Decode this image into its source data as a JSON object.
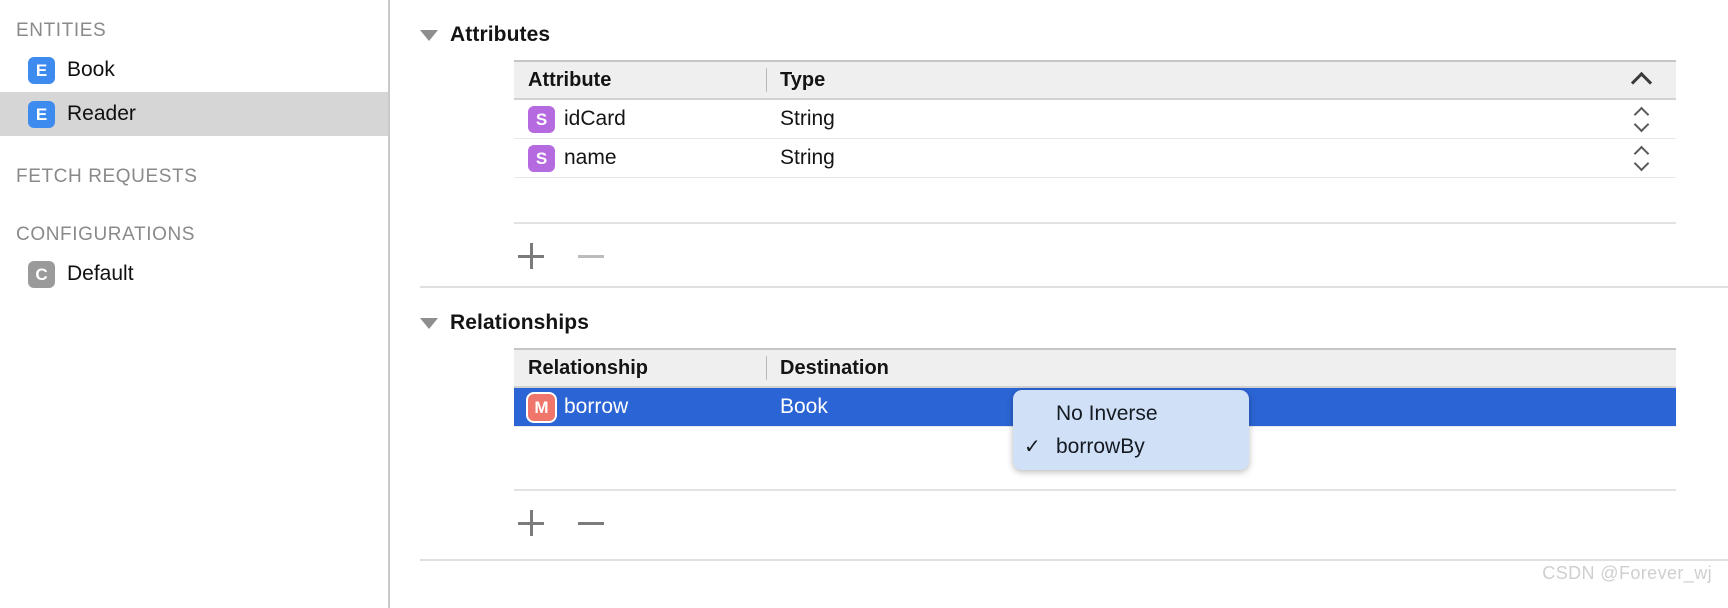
{
  "sidebar": {
    "sections": [
      {
        "title": "ENTITIES",
        "items": [
          {
            "label": "Book",
            "badge": "E",
            "selected": false
          },
          {
            "label": "Reader",
            "badge": "E",
            "selected": true
          }
        ]
      },
      {
        "title": "FETCH REQUESTS",
        "items": []
      },
      {
        "title": "CONFIGURATIONS",
        "items": [
          {
            "label": "Default",
            "badge": "C",
            "selected": false
          }
        ]
      }
    ]
  },
  "attributes_section": {
    "title": "Attributes",
    "columns": {
      "name": "Attribute",
      "type": "Type"
    },
    "sort_indicator": "chevron-up",
    "rows": [
      {
        "badge": "S",
        "name": "idCard",
        "type": "String"
      },
      {
        "badge": "S",
        "name": "name",
        "type": "String"
      }
    ],
    "add_label": "+",
    "remove_label": "−"
  },
  "relationships_section": {
    "title": "Relationships",
    "columns": {
      "name": "Relationship",
      "destination": "Destination"
    },
    "rows": [
      {
        "badge": "M",
        "name": "borrow",
        "destination": "Book",
        "selected": true
      }
    ],
    "add_label": "+",
    "remove_label": "−"
  },
  "inverse_popup": {
    "items": [
      {
        "label": "No Inverse",
        "checked": false,
        "check_glyph": ""
      },
      {
        "label": "borrowBy",
        "checked": true,
        "check_glyph": "✓"
      }
    ]
  },
  "watermark": {
    "text": "CSDN @Forever_wj"
  },
  "colors": {
    "selection_blue": "#2b64d4",
    "sidebar_selection": "#d6d6d6",
    "entity_badge": "#3e8bf0",
    "config_badge": "#9a9a9a",
    "attribute_badge": "#b56ae0",
    "relationship_badge": "#f0756a",
    "popup_background": "#cfe0f7",
    "header_background": "#efefef"
  }
}
